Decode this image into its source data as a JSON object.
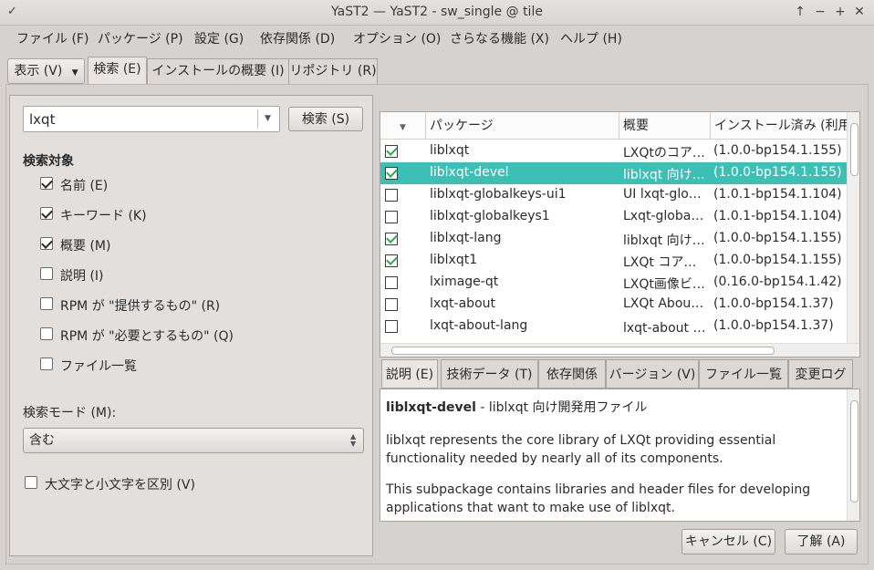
{
  "window": {
    "title": "YaST2 — YaST2 - sw_single @ tile"
  },
  "menubar": {
    "items": [
      "ファイル (F)",
      "パッケージ (P)",
      "設定 (G)",
      "依存関係 (D)",
      "オプション (O)",
      "さらなる機能 (X)",
      "ヘルプ (H)"
    ]
  },
  "tabs": {
    "view": "表示 (V)",
    "search": "検索 (E)",
    "install_summary": "インストールの概要 (I)",
    "repos": "リポジトリ (R)"
  },
  "search": {
    "query": "lxqt",
    "button": "検索 (S)",
    "targets_heading": "検索対象",
    "targets": [
      {
        "label": "名前 (E)",
        "checked": true
      },
      {
        "label": "キーワード (K)",
        "checked": true
      },
      {
        "label": "概要 (M)",
        "checked": true
      },
      {
        "label": "説明 (I)",
        "checked": false
      },
      {
        "label": "RPM が \"提供するもの\" (R)",
        "checked": false
      },
      {
        "label": "RPM が \"必要とするもの\" (Q)",
        "checked": false
      },
      {
        "label": "ファイル一覧",
        "checked": false
      }
    ],
    "mode_label": "検索モード (M):",
    "mode_value": "含む",
    "case_sensitive_label": "大文字と小文字を区別 (V)",
    "case_sensitive": false
  },
  "table": {
    "columns": [
      "パッケージ",
      "概要",
      "インストール済み (利用"
    ],
    "rows": [
      {
        "checked": true,
        "name": "liblxqt",
        "summary": "LXQtのコアライブラリ",
        "version": "(1.0.0-bp154.1.155)",
        "selected": false
      },
      {
        "checked": true,
        "name": "liblxqt-devel",
        "summary": "liblxqt 向け開発用ファイル",
        "version": "(1.0.0-bp154.1.155)",
        "selected": true
      },
      {
        "checked": false,
        "name": "liblxqt-globalkeys-ui1",
        "summary": "UI lxqt-globalkeys",
        "version": "(1.0.1-bp154.1.104)",
        "selected": false
      },
      {
        "checked": false,
        "name": "liblxqt-globalkeys1",
        "summary": "Lxqt-globalkeys",
        "version": "(1.0.1-bp154.1.104)",
        "selected": false
      },
      {
        "checked": true,
        "name": "liblxqt-lang",
        "summary": "liblxqt 向けの翻訳",
        "version": "(1.0.0-bp154.1.155)",
        "selected": false
      },
      {
        "checked": true,
        "name": "liblxqt1",
        "summary": "LXQt コアライブラリ",
        "version": "(1.0.0-bp154.1.155)",
        "selected": false
      },
      {
        "checked": false,
        "name": "lximage-qt",
        "summary": "LXQt画像ビューア",
        "version": "(0.16.0-bp154.1.42)",
        "selected": false
      },
      {
        "checked": false,
        "name": "lxqt-about",
        "summary": "LXQt About dialog",
        "version": "(1.0.0-bp154.1.37)",
        "selected": false
      },
      {
        "checked": false,
        "name": "lxqt-about-lang",
        "summary": "lxqt-about の翻訳",
        "version": "(1.0.0-bp154.1.37)",
        "selected": false
      }
    ]
  },
  "detail_tabs": [
    "説明 (E)",
    "技術データ (T)",
    "依存関係",
    "バージョン (V)",
    "ファイル一覧",
    "変更ログ"
  ],
  "description": {
    "name": "liblxqt-devel",
    "summary": " - liblxqt 向け開発用ファイル",
    "para1": "liblxqt represents the core library of LXQt providing essential functionality needed by nearly all of its components.",
    "para2": "This subpackage contains libraries and header files for developing applications that want to make use of liblxqt."
  },
  "buttons": {
    "cancel": "キャンセル (C)",
    "ok": "了解 (A)"
  }
}
